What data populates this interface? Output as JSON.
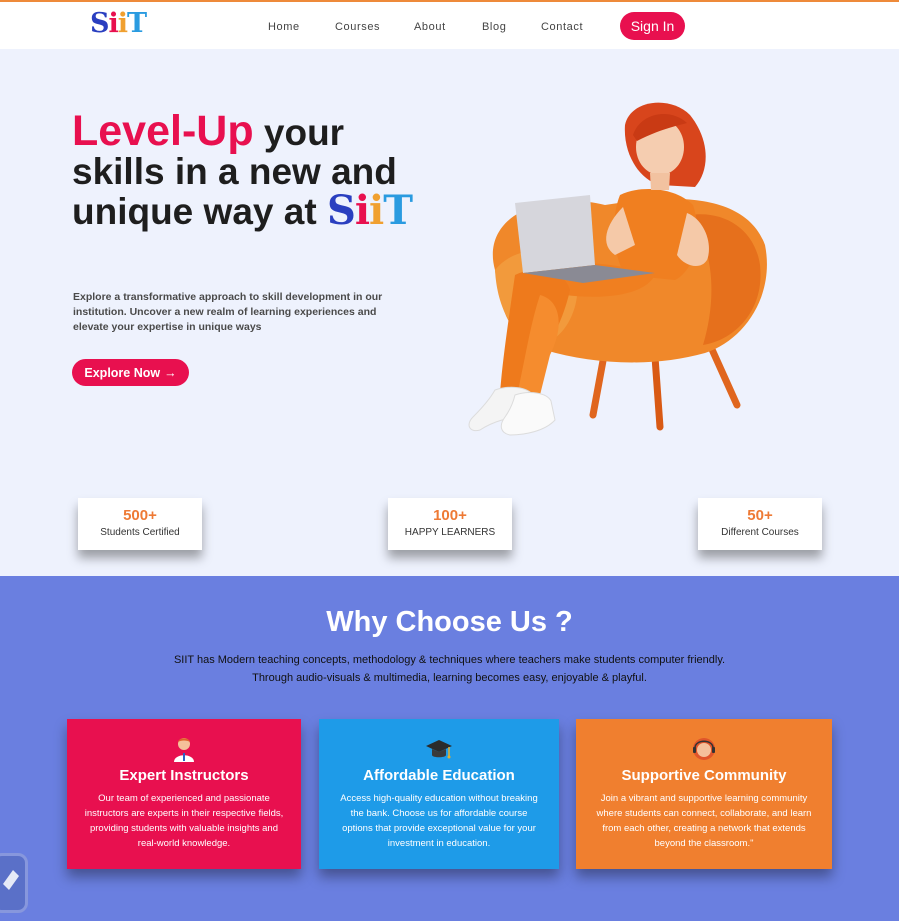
{
  "nav": {
    "logo": {
      "s": "S",
      "i1": "i",
      "i2": "i",
      "t": "T"
    },
    "links": [
      "Home",
      "Courses",
      "About",
      "Blog",
      "Contact"
    ],
    "signin_label": "Sign In"
  },
  "hero": {
    "title_accent": "Level-Up",
    "title_rest": "your skills in a new and unique way at",
    "brand": {
      "s": "S",
      "i1": "i",
      "i2": "i",
      "t": "T"
    },
    "description": "Explore a transformative approach to skill development in our institution. Uncover a new realm of learning experiences and elevate your expertise in unique ways",
    "cta_label": "Explore Now",
    "cta_arrow": "→"
  },
  "stats": [
    {
      "number": "500+",
      "label": "Students Certified"
    },
    {
      "number": "100+",
      "label": "HAPPY LEARNERS"
    },
    {
      "number": "50+",
      "label": "Different Courses"
    }
  ],
  "why": {
    "title": "Why Choose Us ?",
    "subtitle_line1": "SIIT has Modern teaching concepts, methodology & techniques where teachers make students computer friendly.",
    "subtitle_line2": "Through audio-visuals & multimedia, learning becomes easy, enjoyable & playful.",
    "cards": [
      {
        "icon": "teacher-icon",
        "title": "Expert Instructors",
        "text": "Our team of experienced and passionate instructors are experts in their respective fields, providing students with valuable insights and real-world knowledge.",
        "color": "#e8104f"
      },
      {
        "icon": "graduation-cap-icon",
        "title": "Affordable Education",
        "text": "Access high-quality education without breaking the bank. Choose us for affordable course options that provide exceptional value for your investment in education.",
        "color": "#1e9be8"
      },
      {
        "icon": "support-agent-icon",
        "title": "Supportive Community",
        "text": "Join a vibrant and supportive learning community where students can connect, collaborate, and learn from each other, creating a network that extends beyond the classroom.\"",
        "color": "#f07f2f"
      }
    ]
  },
  "colors": {
    "accent": "#e8104f",
    "orange": "#ee7a35",
    "section_bg": "#6a7fe0",
    "hero_bg": "#eef2fd"
  }
}
